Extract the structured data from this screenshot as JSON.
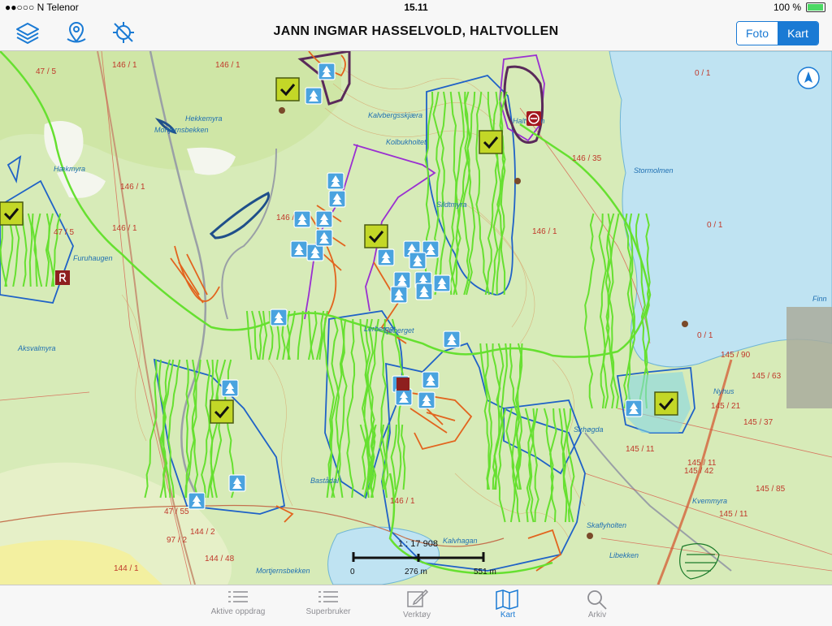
{
  "status": {
    "carrier": "●●○○○ N Telenor",
    "time": "15.11",
    "battery": "100 %"
  },
  "nav": {
    "title": "JANN INGMAR HASSELVOLD, HALTVOLLEN",
    "seg_photo": "Foto",
    "seg_map": "Kart"
  },
  "map": {
    "place_names": [
      "Hekkemyra",
      "Mortjernsbekken",
      "Hækmyra",
      "Furuhaugen",
      "Aksvalmyra",
      "Kalvbergsskjæra",
      "Kolbukholtet",
      "Sildtmyra",
      "Stormolmen",
      "Haltvollen",
      "Finn",
      "Nyhus",
      "Lerberget",
      "Bastådal",
      "Mortjernsbekken",
      "Sirhøgda",
      "Skaflyholten",
      "Kvemmyra",
      "Libekken",
      "Kalvhagan",
      "Tjøberget"
    ],
    "parcel_labels": [
      "146 / 1",
      "47 / 5",
      "146 / 1",
      "146 / 1",
      "146 / 1",
      "146 / 1",
      "0 / 1",
      "0 / 1",
      "0 / 1",
      "146 / 35",
      "146 / 1",
      "47 / 5",
      "145 / 90",
      "145 / 63",
      "145 / 21",
      "145 / 37",
      "145 / 11",
      "145 / 42",
      "145 / 11",
      "145 / 85",
      "145 / 11",
      "146 / 1",
      "97 / 2",
      "144 / 2",
      "144 / 48",
      "47 / 55",
      "144 / 1"
    ],
    "scale_ratio": "1 : 17 908",
    "scale_ticks": [
      "0",
      "276 m",
      "551 m"
    ]
  },
  "tabs": [
    {
      "label": "Aktive oppdrag",
      "icon": "list-icon"
    },
    {
      "label": "Superbruker",
      "icon": "list-icon"
    },
    {
      "label": "Verktøy",
      "icon": "edit-icon"
    },
    {
      "label": "Kart",
      "icon": "map-icon"
    },
    {
      "label": "Arkiv",
      "icon": "search-icon"
    }
  ],
  "colors": {
    "accent": "#1a7ad4",
    "forest": "#cde6a8",
    "water": "#bfe3f2",
    "track": "#66e030",
    "boundary": "#1f62c7",
    "orange": "#e2641e",
    "purple": "#9a2fd1"
  }
}
